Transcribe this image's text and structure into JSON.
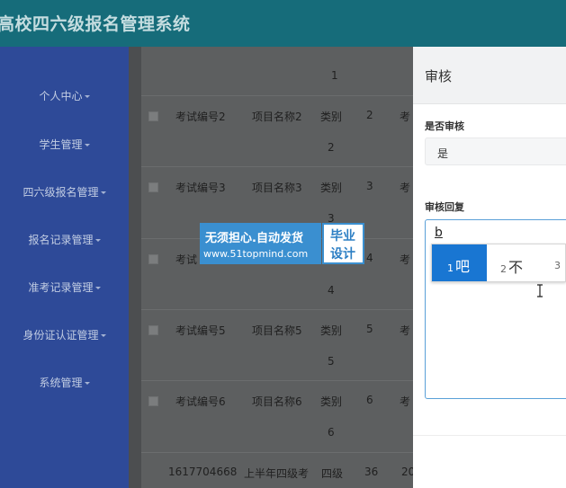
{
  "app": {
    "title": "高校四六级报名管理系统"
  },
  "sidebar": {
    "items": [
      {
        "label": "个人中心"
      },
      {
        "label": "学生管理"
      },
      {
        "label": "四六级报名管理"
      },
      {
        "label": "报名记录管理"
      },
      {
        "label": "准考记录管理"
      },
      {
        "label": "身份证认证管理"
      },
      {
        "label": "系统管理"
      }
    ]
  },
  "table": {
    "rows": [
      {
        "id": "",
        "name": "",
        "type": "",
        "num": "",
        "extra": "",
        "wrap": "1"
      },
      {
        "id": "考试编号2",
        "name": "项目名称2",
        "type": "类别",
        "num": "2",
        "extra": "考",
        "wrap": "2"
      },
      {
        "id": "考试编号3",
        "name": "项目名称3",
        "type": "类别",
        "num": "3",
        "extra": "考",
        "wrap": "3"
      },
      {
        "id": "考试",
        "name": "",
        "type": "",
        "num": "4",
        "extra": "考",
        "wrap": "4"
      },
      {
        "id": "考试编号5",
        "name": "项目名称5",
        "type": "类别",
        "num": "5",
        "extra": "考",
        "wrap": "5"
      },
      {
        "id": "考试编号6",
        "name": "项目名称6",
        "type": "类别",
        "num": "6",
        "extra": "考",
        "wrap": "6"
      },
      {
        "id": "1617704668",
        "name": "上半年四级考",
        "type": "四级",
        "num": "36",
        "extra": "20",
        "wrap": ""
      }
    ]
  },
  "watermark": {
    "line1": "无须担心.自动发货",
    "line2": "www.51topmind.com",
    "right1": "毕业",
    "right2": "设计"
  },
  "panel": {
    "title": "审核",
    "status_label": "是否审核",
    "status_value": "是",
    "reply_label": "审核回复",
    "reply_value": "b"
  },
  "ime": {
    "candidates": [
      {
        "num": "1",
        "text": "吧"
      },
      {
        "num": "2",
        "text": "不"
      },
      {
        "num": "3",
        "text": ""
      }
    ]
  },
  "colors": {
    "header": "#166c7a",
    "sidebar": "#2e4a98",
    "ime_selected": "#1976d2"
  }
}
